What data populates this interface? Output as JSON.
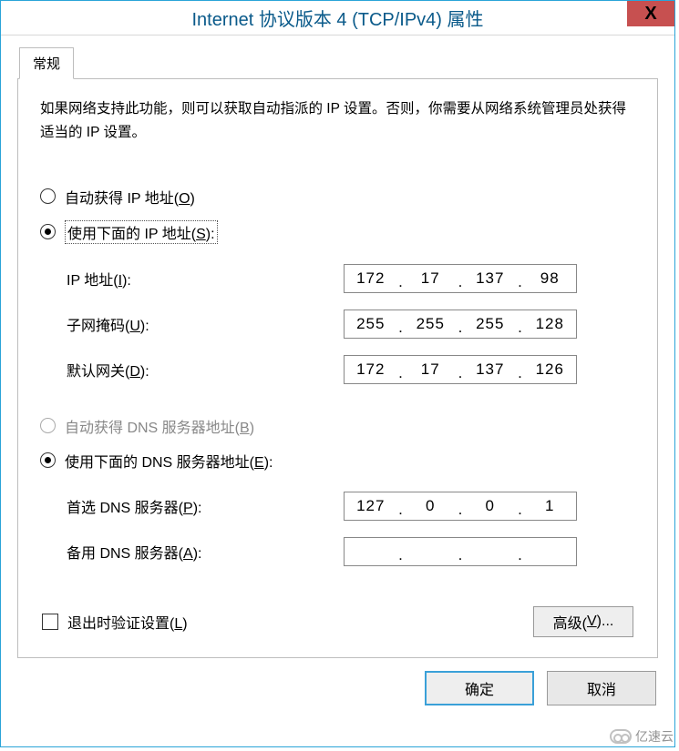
{
  "window": {
    "title": "Internet 协议版本 4 (TCP/IPv4) 属性",
    "close": "X"
  },
  "tab": {
    "label": "常规"
  },
  "description": "如果网络支持此功能，则可以获取自动指派的 IP 设置。否则，你需要从网络系统管理员处获得适当的 IP 设置。",
  "ip": {
    "auto_label_pre": "自动获得 IP 地址(",
    "auto_mn": "O",
    "auto_label_post": ")",
    "manual_label_pre": "使用下面的 IP 地址(",
    "manual_mn": "S",
    "manual_label_post": "):",
    "addr_label_pre": "IP 地址(",
    "addr_mn": "I",
    "addr_label_post": "):",
    "addr": {
      "o1": "172",
      "o2": "17",
      "o3": "137",
      "o4": "98"
    },
    "mask_label_pre": "子网掩码(",
    "mask_mn": "U",
    "mask_label_post": "):",
    "mask": {
      "o1": "255",
      "o2": "255",
      "o3": "255",
      "o4": "128"
    },
    "gw_label_pre": "默认网关(",
    "gw_mn": "D",
    "gw_label_post": "):",
    "gw": {
      "o1": "172",
      "o2": "17",
      "o3": "137",
      "o4": "126"
    }
  },
  "dns": {
    "auto_label_pre": "自动获得 DNS 服务器地址(",
    "auto_mn": "B",
    "auto_label_post": ")",
    "manual_label_pre": "使用下面的 DNS 服务器地址(",
    "manual_mn": "E",
    "manual_label_post": "):",
    "pref_label_pre": "首选 DNS 服务器(",
    "pref_mn": "P",
    "pref_label_post": "):",
    "pref": {
      "o1": "127",
      "o2": "0",
      "o3": "0",
      "o4": "1"
    },
    "alt_label_pre": "备用 DNS 服务器(",
    "alt_mn": "A",
    "alt_label_post": "):",
    "alt": {
      "o1": "",
      "o2": "",
      "o3": "",
      "o4": ""
    }
  },
  "validate": {
    "label_pre": "退出时验证设置(",
    "mn": "L",
    "label_post": ")"
  },
  "buttons": {
    "advanced_pre": "高级(",
    "advanced_mn": "V",
    "advanced_post": ")...",
    "ok": "确定",
    "cancel": "取消"
  },
  "watermark": "亿速云"
}
